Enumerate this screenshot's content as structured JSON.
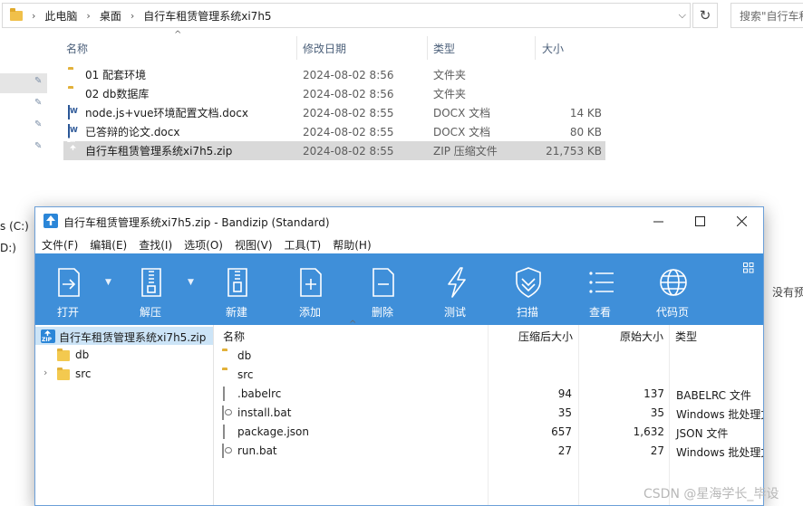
{
  "explorer": {
    "breadcrumb": [
      "此电脑",
      "桌面",
      "自行车租赁管理系统xi7h5"
    ],
    "search_placeholder": "搜索\"自行车租",
    "columns": {
      "name": "名称",
      "date": "修改日期",
      "type": "类型",
      "size": "大小"
    },
    "nav": {
      "drive_c": "s (C:)",
      "drive_d": "D:)"
    },
    "rows": [
      {
        "name": "01  配套环境",
        "date": "2024-08-02 8:56",
        "type": "文件夹",
        "size": "",
        "icon": "folder-icon"
      },
      {
        "name": "02 db数据库",
        "date": "2024-08-02 8:56",
        "type": "文件夹",
        "size": "",
        "icon": "folder-icon"
      },
      {
        "name": "node.js+vue环境配置文档.docx",
        "date": "2024-08-02 8:55",
        "type": "DOCX 文档",
        "size": "14 KB",
        "icon": "word-doc-icon"
      },
      {
        "name": "已答辩的论文.docx",
        "date": "2024-08-02 8:55",
        "type": "DOCX 文档",
        "size": "80 KB",
        "icon": "word-doc-icon"
      },
      {
        "name": "自行车租赁管理系统xi7h5.zip",
        "date": "2024-08-02 8:55",
        "type": "ZIP 压缩文件",
        "size": "21,753 KB",
        "icon": "zip-icon"
      }
    ],
    "right_text": "没有预",
    "watermark": "CSDN @星海学长_毕设"
  },
  "bandizip": {
    "title": "自行车租赁管理系统xi7h5.zip - Bandizip (Standard)",
    "menu": [
      "文件(F)",
      "编辑(E)",
      "查找(I)",
      "选项(O)",
      "视图(V)",
      "工具(T)",
      "帮助(H)"
    ],
    "toolbar": {
      "open": "打开",
      "extract": "解压",
      "new": "新建",
      "add": "添加",
      "delete": "删除",
      "test": "测试",
      "scan": "扫描",
      "view": "查看",
      "codepage": "代码页"
    },
    "tree": {
      "root": "自行车租赁管理系统xi7h5.zip",
      "items": [
        "db",
        "src"
      ]
    },
    "columns": {
      "name": "名称",
      "compressed": "压缩后大小",
      "original": "原始大小",
      "type": "类型"
    },
    "rows": [
      {
        "name": "db",
        "compressed": "",
        "original": "",
        "type": "",
        "icon": "folder-icon"
      },
      {
        "name": "src",
        "compressed": "",
        "original": "",
        "type": "",
        "icon": "folder-icon"
      },
      {
        "name": ".babelrc",
        "compressed": "94",
        "original": "137",
        "type": "BABELRC 文件",
        "icon": "file-icon"
      },
      {
        "name": "install.bat",
        "compressed": "35",
        "original": "35",
        "type": "Windows 批处理文",
        "icon": "batch-file-icon"
      },
      {
        "name": "package.json",
        "compressed": "657",
        "original": "1,632",
        "type": "JSON 文件",
        "icon": "file-icon"
      },
      {
        "name": "run.bat",
        "compressed": "27",
        "original": "27",
        "type": "Windows 批处理文",
        "icon": "batch-file-icon"
      }
    ]
  }
}
